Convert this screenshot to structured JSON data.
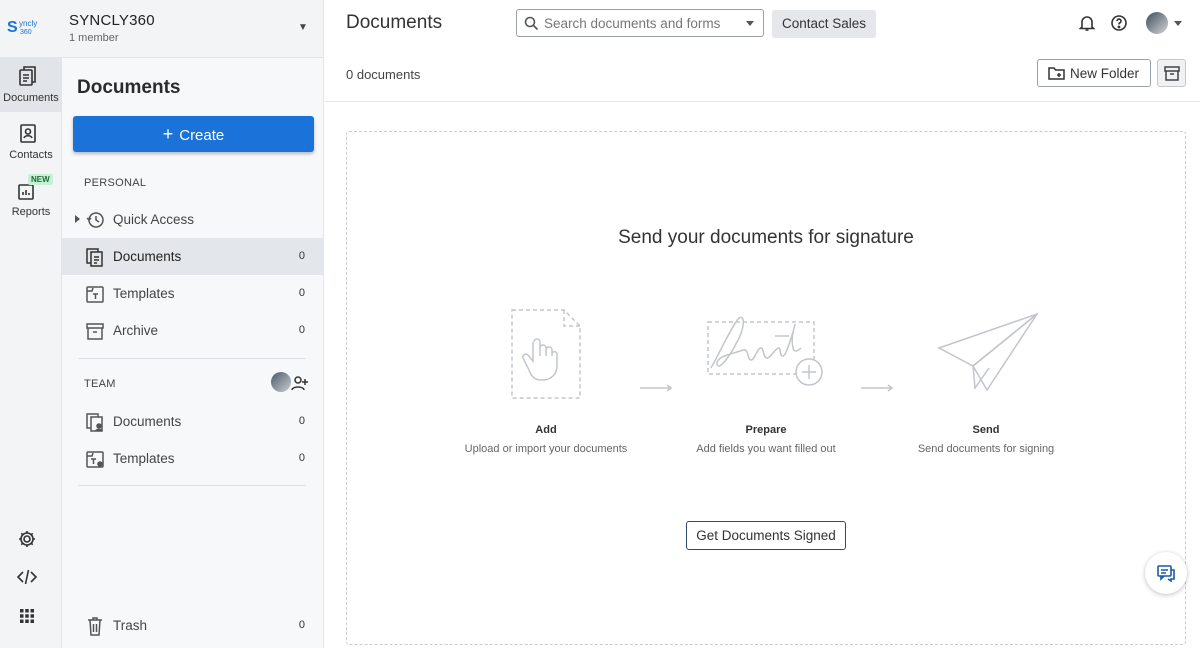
{
  "org": {
    "logo_text": "Syncly 360",
    "name": "SYNCLY360",
    "members": "1 member"
  },
  "rail": [
    {
      "label": "Documents",
      "icon": "documents-icon"
    },
    {
      "label": "Contacts",
      "icon": "contacts-icon"
    },
    {
      "label": "Reports",
      "icon": "reports-icon",
      "badge": "NEW"
    }
  ],
  "rail_bottom": [
    "settings-icon",
    "code-icon",
    "apps-grid-icon"
  ],
  "sidebar": {
    "title": "Documents",
    "create_label": "Create",
    "personal_label": "PERSONAL",
    "personal_items": [
      {
        "label": "Quick Access",
        "count": ""
      },
      {
        "label": "Documents",
        "count": "0"
      },
      {
        "label": "Templates",
        "count": "0"
      },
      {
        "label": "Archive",
        "count": "0"
      }
    ],
    "team_label": "TEAM",
    "team_items": [
      {
        "label": "Documents",
        "count": "0"
      },
      {
        "label": "Templates",
        "count": "0"
      }
    ],
    "trash": {
      "label": "Trash",
      "count": "0"
    }
  },
  "header": {
    "title": "Documents",
    "search_placeholder": "Search documents and forms",
    "contact_sales": "Contact Sales"
  },
  "toolbar": {
    "doc_count": "0 documents",
    "new_folder": "New Folder"
  },
  "empty_state": {
    "title": "Send your documents for signature",
    "steps": [
      {
        "title": "Add",
        "desc": "Upload or import your documents"
      },
      {
        "title": "Prepare",
        "desc": "Add fields you want filled out"
      },
      {
        "title": "Send",
        "desc": "Send documents for signing"
      }
    ],
    "cta": "Get Documents Signed"
  },
  "colors": {
    "primary": "#1b72d9",
    "rail_bg": "#f3f4f5",
    "new_badge": "#c8f0d5"
  }
}
